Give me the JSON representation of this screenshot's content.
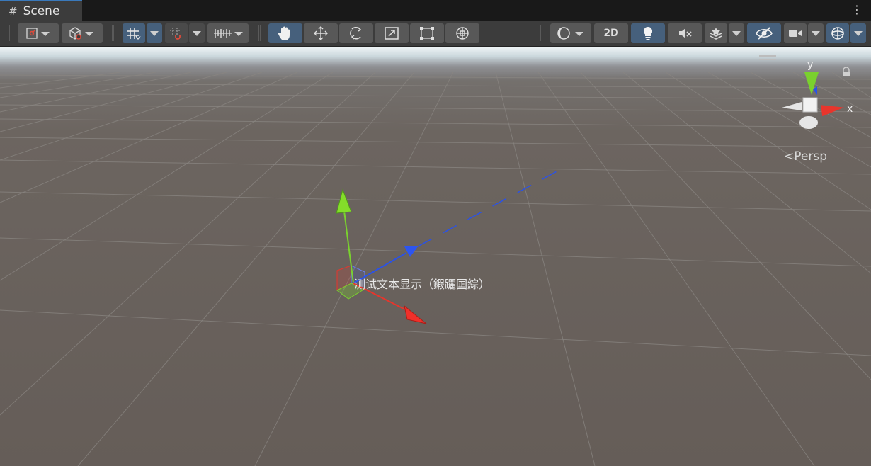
{
  "tab": {
    "icon": "grid-hash-icon",
    "glyph": "#",
    "label": "Scene"
  },
  "toolbar": {
    "two_d_label": "2D",
    "colors": {
      "active": "#46607c",
      "button": "#585858",
      "bar": "#3c3c3c"
    }
  },
  "viewport": {
    "object_label": "测试文本显示（鍜躧囸綜）",
    "projection_label": "Persp",
    "axis_labels": {
      "y": "y",
      "x": "x"
    },
    "axis_colors": {
      "x": "#e8352c",
      "y": "#7ad12e",
      "z": "#2a52e8"
    }
  }
}
